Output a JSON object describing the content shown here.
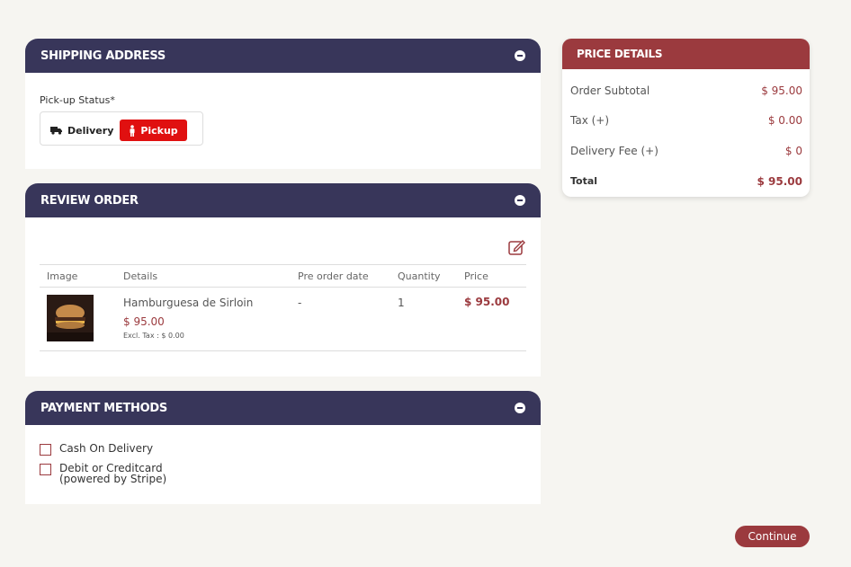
{
  "shipping": {
    "title": "SHIPPING ADDRESS",
    "pickup_status_label": "Pick-up Status*",
    "delivery_label": "Delivery",
    "pickup_label": "Pickup"
  },
  "review": {
    "title": "REVIEW ORDER",
    "columns": [
      "Image",
      "Details",
      "Pre order date",
      "Quantity",
      "Price"
    ],
    "items": [
      {
        "name": "Hamburguesa de Sirloin",
        "unit_price": "$ 95.00",
        "excl_tax": "Excl. Tax : $ 0.00",
        "pre_order_date": "-",
        "quantity": "1",
        "price": "$ 95.00"
      }
    ]
  },
  "payment": {
    "title": "PAYMENT METHODS",
    "options": [
      {
        "label": "Cash On Delivery"
      },
      {
        "label": "Debit or Creditcard",
        "sublabel": "(powered by Stripe)"
      }
    ]
  },
  "price_details": {
    "title": "PRICE DETAILS",
    "rows": [
      {
        "label": "Order Subtotal",
        "value": "$ 95.00"
      },
      {
        "label": "Tax (+)",
        "value": "$ 0.00"
      },
      {
        "label": "Delivery Fee (+)",
        "value": "$ 0"
      },
      {
        "label": "Total",
        "value": "$ 95.00"
      }
    ]
  },
  "continue_label": "Continue",
  "colors": {
    "header_bg": "#38365a",
    "accent": "#9b3a3e",
    "pickup_active": "#e01010",
    "page_bg": "#f6f5f1"
  }
}
